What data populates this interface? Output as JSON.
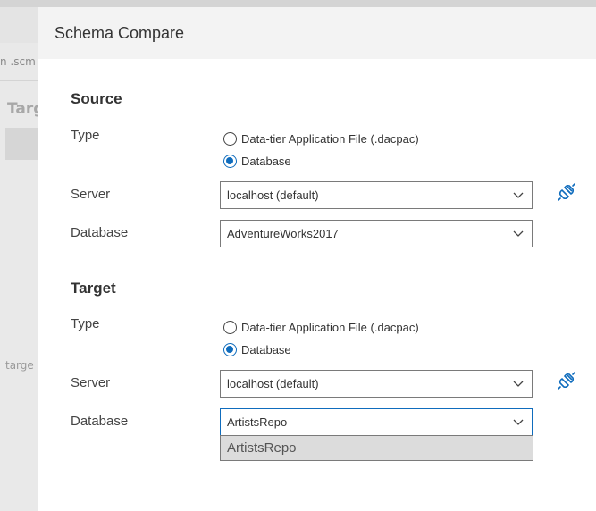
{
  "background": {
    "file_tab_text": "n .scm",
    "target_heading": "Targ",
    "target_text": "targe"
  },
  "dialog": {
    "title": "Schema Compare",
    "source": {
      "heading": "Source",
      "type_label": "Type",
      "type_options": [
        "Data-tier Application File (.dacpac)",
        "Database"
      ],
      "type_selected": "Database",
      "server_label": "Server",
      "server_value": "localhost (default)",
      "database_label": "Database",
      "database_value": "AdventureWorks2017"
    },
    "target": {
      "heading": "Target",
      "type_label": "Type",
      "type_options": [
        "Data-tier Application File (.dacpac)",
        "Database"
      ],
      "type_selected": "Database",
      "server_label": "Server",
      "server_value": "localhost (default)",
      "database_label": "Database",
      "database_value": "ArtistsRepo",
      "database_dropdown_options": [
        "ArtistsRepo"
      ]
    }
  },
  "colors": {
    "accent": "#0f6cbd",
    "header_bg": "#f3f3f3",
    "dropdown_option_bg": "#dcdcdc"
  },
  "icons": {
    "connect": "plug-connect-icon",
    "dropdown": "chevron-down-icon"
  }
}
